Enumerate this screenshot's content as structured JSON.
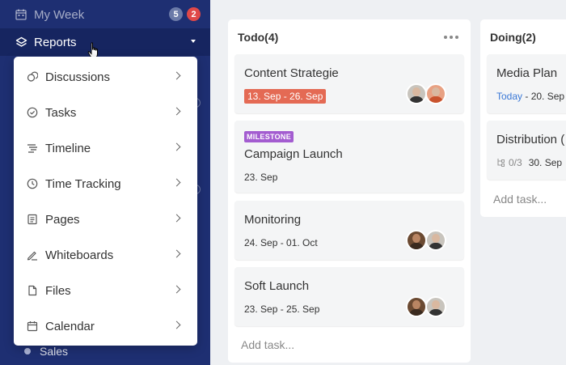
{
  "sidebar": {
    "my_week": {
      "label": "My Week",
      "badge_count": "5",
      "badge_alert": "2"
    },
    "reports": {
      "label": "Reports"
    },
    "sales": {
      "label": "Sales"
    }
  },
  "reports_menu": {
    "items": [
      {
        "label": "Discussions",
        "icon": "discussions-icon"
      },
      {
        "label": "Tasks",
        "icon": "tasks-icon"
      },
      {
        "label": "Timeline",
        "icon": "timeline-icon"
      },
      {
        "label": "Time Tracking",
        "icon": "time-tracking-icon"
      },
      {
        "label": "Pages",
        "icon": "pages-icon"
      },
      {
        "label": "Whiteboards",
        "icon": "whiteboards-icon"
      },
      {
        "label": "Files",
        "icon": "files-icon"
      },
      {
        "label": "Calendar",
        "icon": "calendar-icon"
      }
    ]
  },
  "board": {
    "todo": {
      "title": "Todo(4)",
      "add_task": "Add task...",
      "cards": [
        {
          "title": "Content Strategie",
          "date": "13. Sep - 26. Sep"
        },
        {
          "milestone": "MILESTONE",
          "title": "Campaign Launch",
          "date": "23. Sep"
        },
        {
          "title": "Monitoring",
          "date": "24. Sep - 01. Oct"
        },
        {
          "title": "Soft Launch",
          "date": "23. Sep - 25. Sep"
        }
      ]
    },
    "doing": {
      "title": "Doing(2)",
      "add_task": "Add task...",
      "cards": [
        {
          "title": "Media Plan",
          "date_today": "Today",
          "date_rest": " - 20. Sep"
        },
        {
          "title": "Distribution (",
          "subtasks": "0/3",
          "date": "30. Sep"
        }
      ]
    }
  },
  "colors": {
    "sidebar_bg": "#1e2f72",
    "overdue_date": "#e46a54",
    "milestone": "#a35cd0",
    "today": "#3a78d6",
    "badge_alert": "#e04848"
  }
}
